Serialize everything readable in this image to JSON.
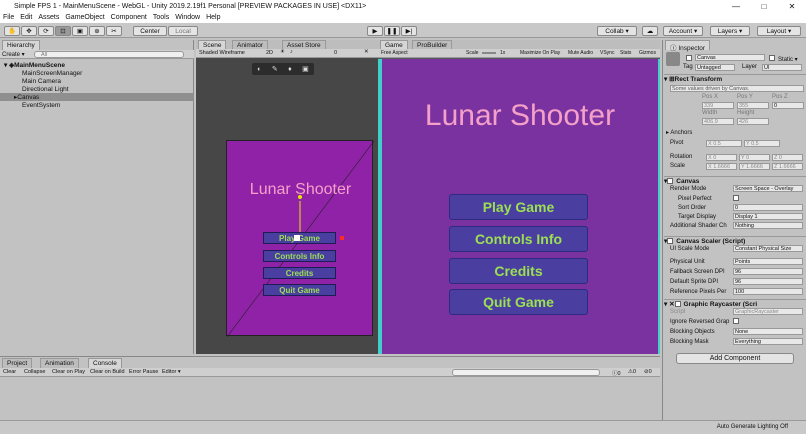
{
  "window": {
    "title": "Simple FPS 1 - MainMenuScene - WebGL - Unity 2019.2.19f1 Personal [PREVIEW PACKAGES IN USE] <DX11>",
    "minimize": "—",
    "maximize": "□",
    "close": "✕"
  },
  "menu": [
    "File",
    "Edit",
    "Assets",
    "GameObject",
    "Component",
    "Tools",
    "Window",
    "Help"
  ],
  "toolbar": {
    "center": "Center",
    "local": "Local",
    "collab": "Collab ▾",
    "account": "Account ▾",
    "layers": "Layers ▾",
    "layout": "Layout ▾"
  },
  "hierarchy": {
    "tab": "Hierarchy",
    "create": "Create ▾",
    "search_placeholder": "All",
    "items": [
      {
        "label": "MainMenuScene"
      },
      {
        "label": "MainScreenManager"
      },
      {
        "label": "Main Camera"
      },
      {
        "label": "Directional Light"
      },
      {
        "label": "Canvas"
      },
      {
        "label": "EventSystem"
      }
    ]
  },
  "scene": {
    "tabs": [
      "Scene",
      "Animator",
      "Asset Store"
    ],
    "shading": "Shaded Wireframe",
    "mode2d": "2D",
    "gizmo_count": "0",
    "title": "Lunar Shooter",
    "buttons": [
      "Play Game",
      "Controls Info",
      "Credits",
      "Quit Game"
    ]
  },
  "game": {
    "tabs": [
      "Game",
      "ProBuilder"
    ],
    "aspect": "Free Aspect",
    "scale_label": "Scale",
    "scale_value": "1x",
    "options": [
      "Maximize On Play",
      "Mute Audio",
      "VSync",
      "Stats",
      "Gizmos"
    ],
    "title": "Lunar Shooter",
    "buttons": [
      "Play Game",
      "Controls Info",
      "Credits",
      "Quit Game"
    ]
  },
  "inspector": {
    "tab": "Inspector",
    "name": "Canvas",
    "static": "Static ▾",
    "tag_label": "Tag",
    "tag": "Untagged",
    "layer_label": "Layer",
    "layer": "UI",
    "rect_transform": "Rect Transform",
    "driven_note": "Some values driven by Canvas.",
    "pos_labels": [
      "Pos X",
      "Pos Y",
      "Pos Z"
    ],
    "pos_values": [
      "339",
      "355",
      "0"
    ],
    "size_labels": [
      "Width",
      "Height"
    ],
    "size_values": [
      "406.9",
      "426"
    ],
    "anchors": "Anchors",
    "pivot_label": "Pivot",
    "pivot": [
      "X 0.5",
      "Y 0.5"
    ],
    "rotation_label": "Rotation",
    "rotation": [
      "X 0",
      "Y 0",
      "Z 0"
    ],
    "scale_label": "Scale",
    "scale": [
      "X 1.6666",
      "Y 1.6666",
      "Z 1.6666"
    ],
    "canvas": "Canvas",
    "render_mode_label": "Render Mode",
    "render_mode": "Screen Space - Overlay",
    "pixel_perfect_label": "Pixel Perfect",
    "sort_order_label": "Sort Order",
    "sort_order": "0",
    "target_display_label": "Target Display",
    "target_display": "Display 1",
    "add_shader_label": "Additional Shader Ch",
    "add_shader": "Nothing",
    "scaler": "Canvas Scaler (Script)",
    "ui_scale_label": "UI Scale Mode",
    "ui_scale": "Constant Physical Size",
    "phys_unit_label": "Physical Unit",
    "phys_unit": "Points",
    "fallback_label": "Fallback Screen DPI",
    "fallback": "96",
    "default_dpi_label": "Default Sprite DPI",
    "default_dpi": "96",
    "ref_ppu_label": "Reference Pixels Per",
    "ref_ppu": "100",
    "raycaster": "Graphic Raycaster (Scri",
    "script_label": "Script",
    "script": "GraphicRaycaster",
    "ignore_label": "Ignore Reversed Grap",
    "blocking_obj_label": "Blocking Objects",
    "blocking_obj": "None",
    "blocking_mask_label": "Blocking Mask",
    "blocking_mask": "Everything",
    "add_component": "Add Component"
  },
  "console": {
    "tabs": [
      "Project",
      "Animation",
      "Console"
    ],
    "buttons": [
      "Clear",
      "Collapse",
      "Clear on Play",
      "Clear on Build",
      "Error Pause",
      "Editor ▾"
    ],
    "counts": [
      "0",
      "0",
      "0"
    ]
  },
  "status": {
    "text": "Auto Generate Lighting Off"
  },
  "colors": {
    "purple": "#9022a8",
    "game_bg": "#7932a0",
    "button": "#4a3fa0",
    "button_text": "#9be052",
    "title": "#f5a0c8"
  }
}
